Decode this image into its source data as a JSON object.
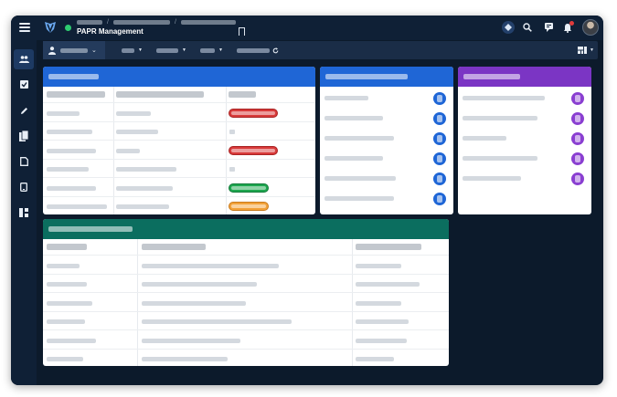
{
  "app": {
    "title": "PAPR Management",
    "status_color": "#2ecc71",
    "header_bg": "#0f2036"
  },
  "icons": {
    "menu": "menu-icon",
    "logo": "shield-logo-icon",
    "bookmark": "bookmark-icon",
    "help": "help-diamond-icon",
    "search": "search-icon",
    "messages": "chat-icon",
    "notifications": "bell-icon",
    "sidebar": [
      "users-icon",
      "checkbox-icon",
      "pencil-icon",
      "copy-icon",
      "document-icon",
      "tablet-icon",
      "layout-icon"
    ],
    "toolbar_user": "person-icon",
    "refresh": "refresh-icon",
    "layout_toggle": "grid-layout-icon"
  },
  "panels": {
    "table_top": {
      "header_color": "#1f66d6"
    },
    "list_blue": {
      "header_color": "#1f66d6",
      "chip_color": "#1f66d6"
    },
    "list_purple": {
      "header_color": "#7b35c4",
      "chip_color": "#8a3fd1"
    },
    "table_bottom": {
      "header_color": "#0b6e5f"
    }
  },
  "status_colors": {
    "red": "#d83a3a",
    "green": "#1ea64f",
    "orange": "#f2a23a"
  }
}
